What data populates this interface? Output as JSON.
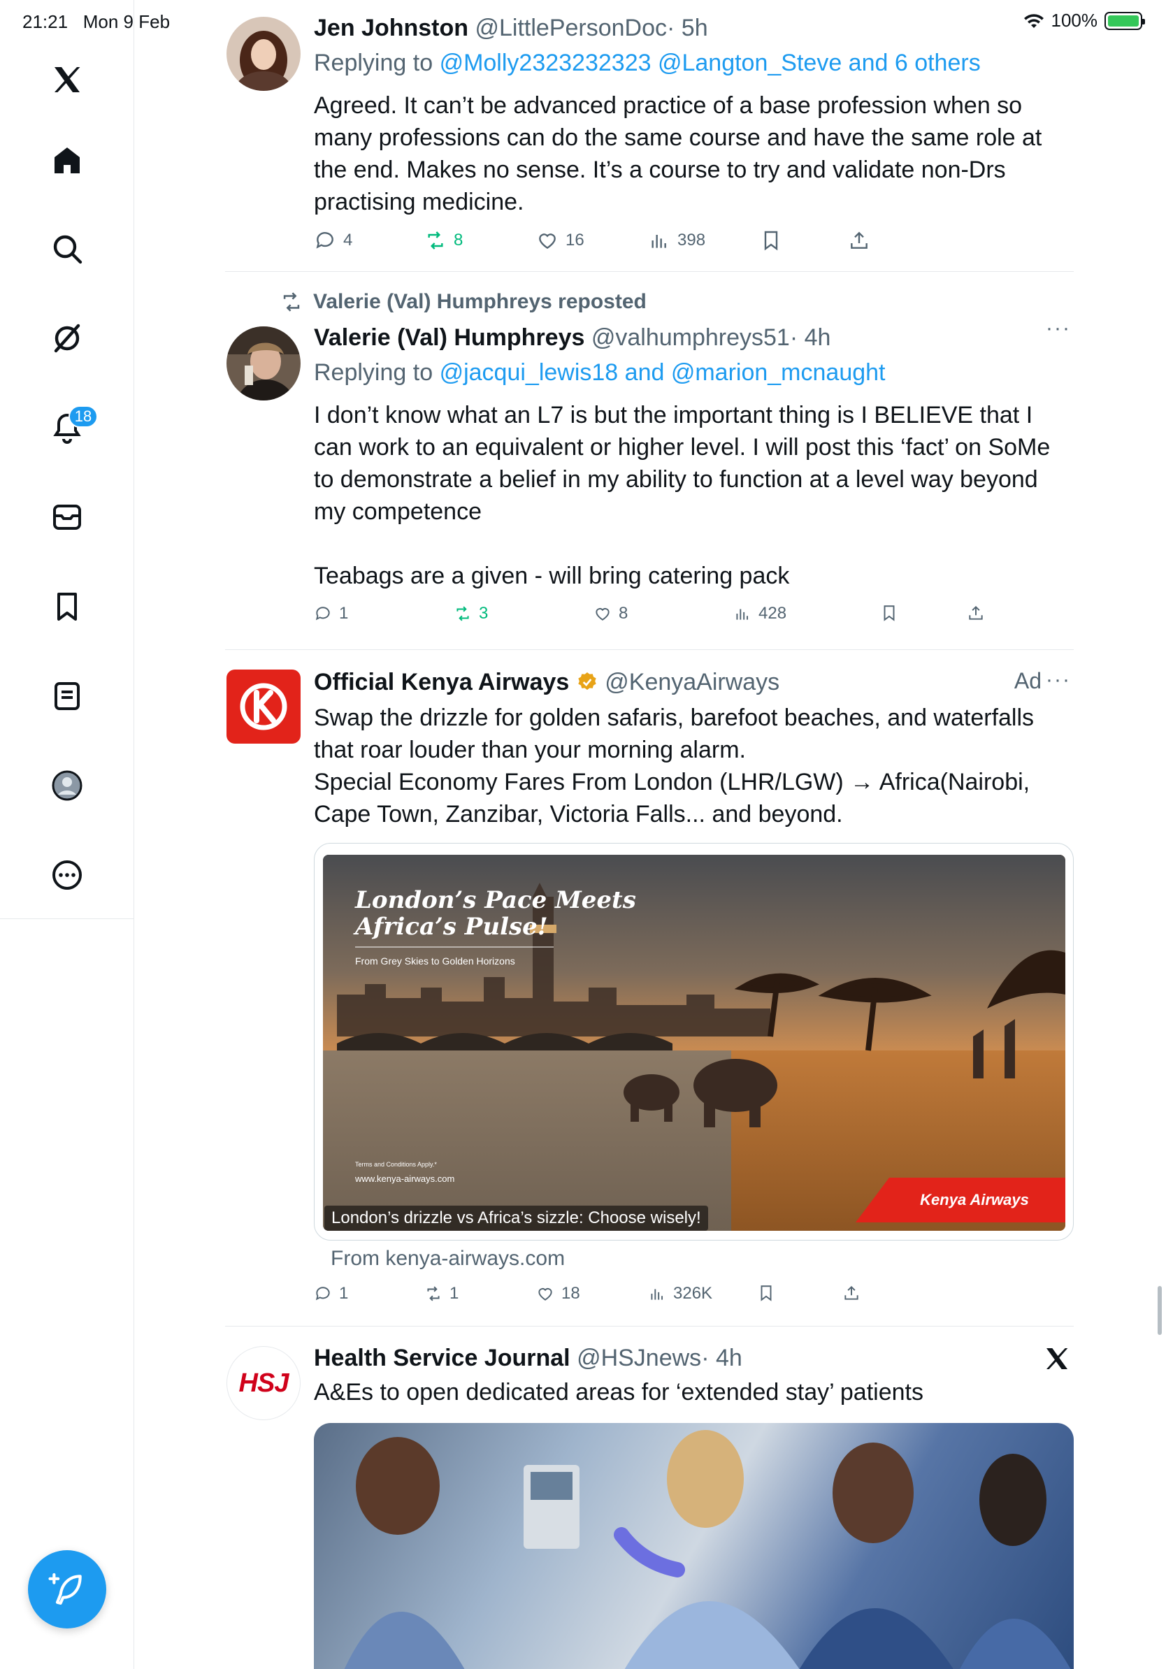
{
  "status_bar": {
    "time": "21:21",
    "date": "Mon 9 Feb",
    "battery": "100%"
  },
  "colors": {
    "accent": "#1d9bf0",
    "repost_green": "#00ba7c",
    "secondary_text": "#536471",
    "kenya_red": "#e2231a"
  },
  "sidebar": {
    "items": [
      {
        "icon": "x-logo-icon"
      },
      {
        "icon": "home-icon"
      },
      {
        "icon": "search-icon"
      },
      {
        "icon": "grok-icon"
      },
      {
        "icon": "notifications-icon",
        "badge": "18"
      },
      {
        "icon": "messages-icon"
      },
      {
        "icon": "bookmarks-icon"
      },
      {
        "icon": "lists-icon"
      },
      {
        "icon": "profile-icon"
      },
      {
        "icon": "more-icon"
      }
    ],
    "compose_icon": "compose-icon"
  },
  "tweets": [
    {
      "name": "Jen Johnston",
      "handle": "@LittlePersonDoc",
      "time": "· 5h",
      "replying_prefix": "Replying to",
      "replying_to": "@Molly2323232323 @Langton_Steve and 6 others",
      "text": "Agreed. It can’t be advanced practice of a base profession when so many professions can do the same course and have the same role at the end. Makes no sense. It’s a course to try and validate non-Drs practising medicine.",
      "replies": "4",
      "reposts": "8",
      "likes": "16",
      "views": "398"
    },
    {
      "repost_label": "Valerie (Val) Humphreys reposted",
      "name": "Valerie (Val) Humphreys",
      "handle": "@valhumphreys51",
      "time": "· 4h",
      "replying_prefix": "Replying to",
      "replying_to": "@jacqui_lewis18 and @marion_mcnaught",
      "text": "I don’t know what an L7 is but the important thing is I BELIEVE that I can work to an equivalent or higher level. I will post this ‘fact’ on SoMe to demonstrate a belief in my ability to function at a level way beyond my competence\n\nTeabags are a given - will bring catering pack",
      "replies": "1",
      "reposts": "3",
      "likes": "8",
      "views": "428",
      "more": "···"
    },
    {
      "name": "Official Kenya Airways",
      "handle": "@KenyaAirways",
      "ad_label": "Ad",
      "more": "···",
      "text": "Swap the drizzle for golden safaris, barefoot beaches, and waterfalls that roar louder than your morning alarm.\nSpecial Economy Fares From London (LHR/LGW) → Africa(Nairobi, Cape Town, Zanzibar, Victoria Falls... and beyond.",
      "card": {
        "headline_1": "London’s Pace Meets",
        "headline_2": "Africa’s Pulse!",
        "subline": "From Grey Skies to Golden Horizons",
        "terms": "Terms and Conditions Apply.*",
        "site": "www.kenya-airways.com",
        "logo_text": "Kenya Airways",
        "caption": "London’s drizzle vs Africa’s sizzle: Choose wisely!"
      },
      "from": "From kenya-airways.com",
      "replies": "1",
      "reposts": "1",
      "likes": "18",
      "views": "326K"
    },
    {
      "name": "Health Service Journal",
      "handle": "@HSJnews",
      "time": "· 4h",
      "avatar_text": "HSJ",
      "text": "A&Es to open dedicated areas for ‘extended stay’ patients"
    }
  ]
}
